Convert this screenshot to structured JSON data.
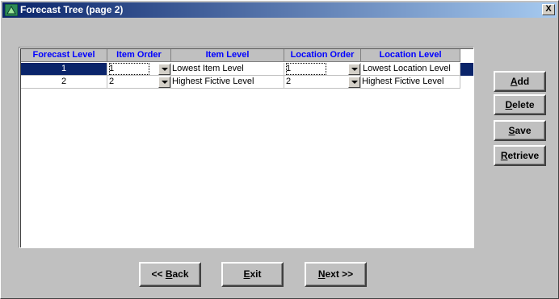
{
  "window": {
    "title": "Forecast Tree (page 2)",
    "close_label": "X",
    "accent_color": "#0a246a"
  },
  "grid": {
    "columns": [
      "Forecast Level",
      "Item Order",
      "Item Level",
      "Location Order",
      "Location Level"
    ],
    "rows": [
      {
        "forecast_level": "1",
        "item_order": "1",
        "item_level": "Lowest Item Level",
        "location_order": "1",
        "location_level": "Lowest Location Level",
        "selected": true
      },
      {
        "forecast_level": "2",
        "item_order": "2",
        "item_level": "Highest Fictive Level",
        "location_order": "2",
        "location_level": "Highest Fictive Level",
        "selected": false
      }
    ]
  },
  "actions": {
    "add": {
      "u": "A",
      "rest": "dd"
    },
    "delete": {
      "u": "D",
      "rest": "elete"
    },
    "save": {
      "u": "S",
      "rest": "ave"
    },
    "retrieve": {
      "u": "R",
      "rest": "etrieve"
    }
  },
  "nav": {
    "back": {
      "pre": "<< ",
      "u": "B",
      "rest": "ack"
    },
    "exit": {
      "u": "E",
      "rest": "xit"
    },
    "next": {
      "u": "N",
      "rest": "ext >>"
    }
  },
  "icons": {
    "app": "tree-app-icon",
    "dropdown": "chevron-down-icon"
  }
}
